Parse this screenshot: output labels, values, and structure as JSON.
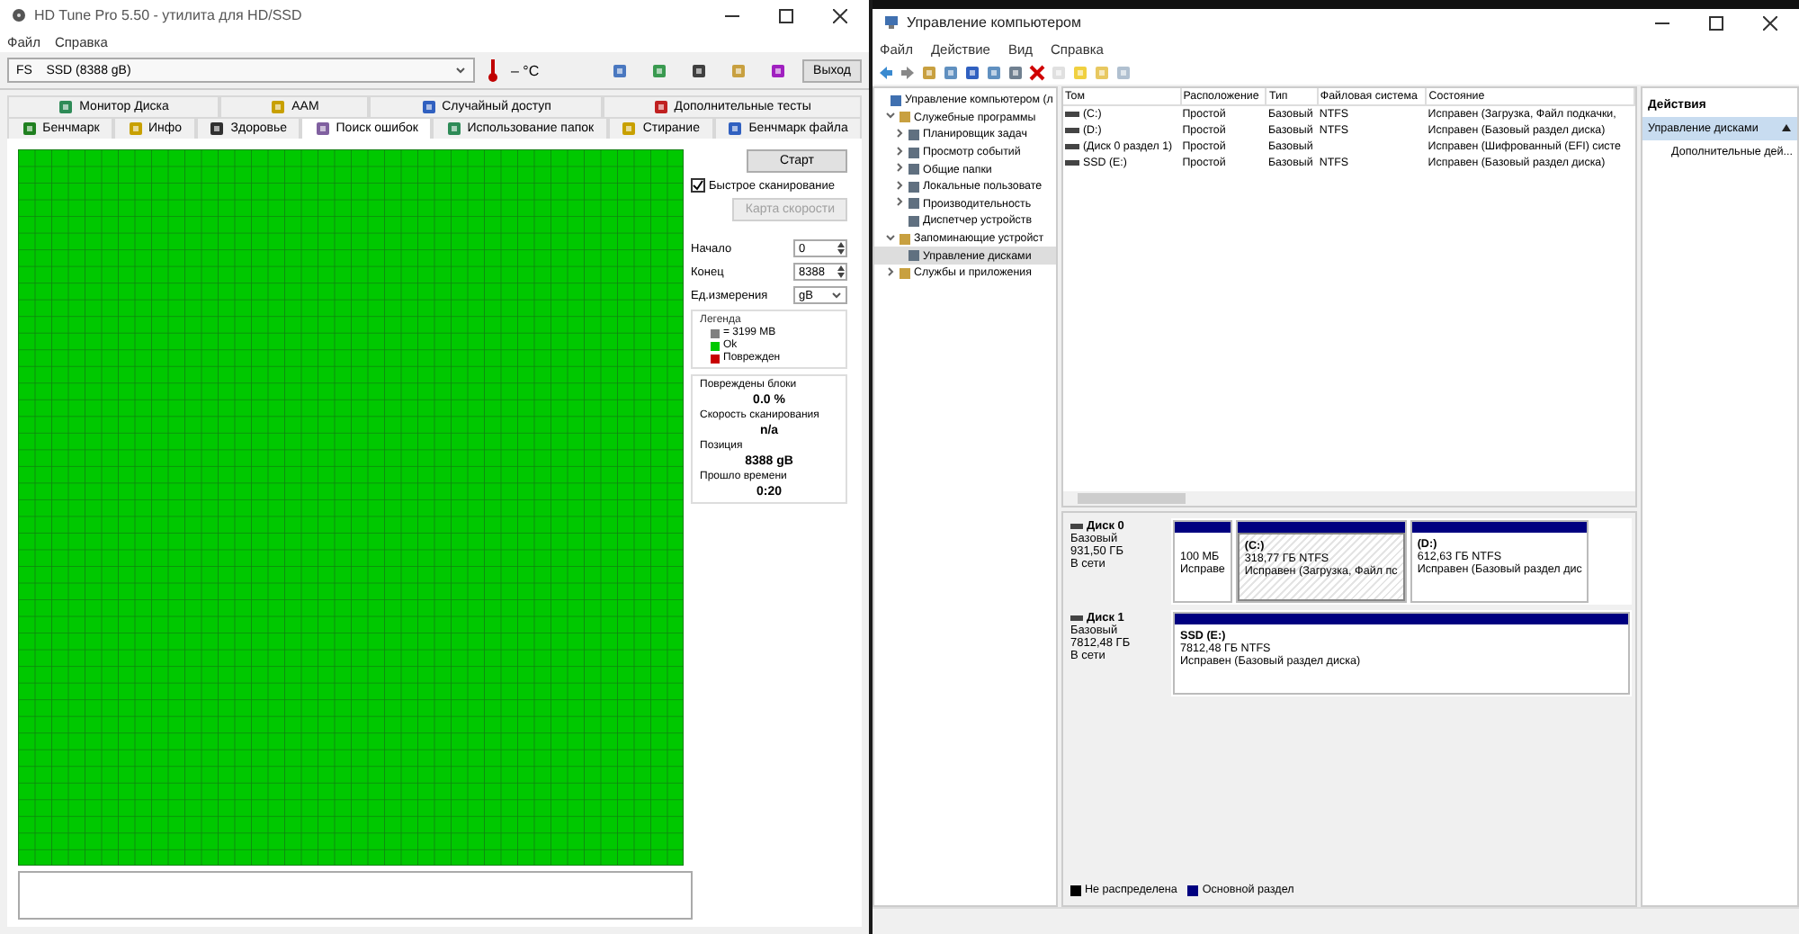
{
  "hdtune": {
    "window": {
      "title": "HD Tune Pro 5.50 - утилита для HD/SSD"
    },
    "menu": [
      "Файл",
      "Справка"
    ],
    "drive": {
      "value": "FS    SSD (8388 gB)"
    },
    "temperature": "– °C",
    "exit_button": "Выход",
    "tabs_top": [
      {
        "label": "Монитор Диска",
        "selected": false
      },
      {
        "label": "AAM",
        "selected": false
      },
      {
        "label": "Случайный доступ",
        "selected": false
      },
      {
        "label": "Дополнительные  тесты",
        "selected": false
      }
    ],
    "tabs_bottom": [
      {
        "label": "Бенчмарк",
        "selected": false
      },
      {
        "label": "Инфо",
        "selected": false
      },
      {
        "label": "Здоровье",
        "selected": false
      },
      {
        "label": "Поиск ошибок",
        "selected": true
      },
      {
        "label": "Использование папок",
        "selected": false
      },
      {
        "label": "Стирание",
        "selected": false
      },
      {
        "label": "Бенчмарк файла",
        "selected": false
      }
    ],
    "start_button": "Старт",
    "quick_scan": {
      "label": "Быстрое сканирование",
      "checked": true
    },
    "speed_map_button": {
      "label": "Карта скорости",
      "disabled": true
    },
    "fields": [
      {
        "label": "Начало",
        "value": "0",
        "kind": "spin"
      },
      {
        "label": "Конец",
        "value": "8388",
        "kind": "spin"
      },
      {
        "label": "Ед.измерения",
        "value": "gB",
        "kind": "select"
      }
    ],
    "legend": {
      "title": "Легенда",
      "items": [
        {
          "label": "= 3199 MB",
          "color": "#808080"
        },
        {
          "label": "Ok",
          "color": "#00c800"
        },
        {
          "label": "Поврежден",
          "color": "#c80000"
        }
      ]
    },
    "stats": [
      {
        "label": "Повреждены блоки",
        "value": "0.0 %"
      },
      {
        "label": "Скорость сканирования",
        "value": "n/a"
      },
      {
        "label": "Позиция",
        "value": "8388 gB"
      },
      {
        "label": "Прошло времени",
        "value": "0:20"
      }
    ]
  },
  "computer_management": {
    "window": {
      "title": "Управление компьютером"
    },
    "menu": [
      "Файл",
      "Действие",
      "Вид",
      "Справка"
    ],
    "tree": [
      {
        "label": "Управление компьютером (л",
        "selected": false,
        "children": [
          {
            "label": "Служебные программы",
            "expanded": true,
            "selected": false,
            "children": [
              {
                "label": "Планировщик задач",
                "expanded": false,
                "selected": false
              },
              {
                "label": "Просмотр событий",
                "expanded": false,
                "selected": false
              },
              {
                "label": "Общие папки",
                "expanded": false,
                "selected": false
              },
              {
                "label": "Локальные пользовате",
                "expanded": false,
                "selected": false
              },
              {
                "label": "Производительность",
                "expanded": false,
                "selected": false
              },
              {
                "label": "Диспетчер устройств",
                "selected": false
              }
            ]
          },
          {
            "label": "Запоминающие устройст",
            "expanded": true,
            "selected": false,
            "children": [
              {
                "label": "Управление дисками",
                "selected": true
              }
            ]
          },
          {
            "label": "Службы и приложения",
            "expanded": false,
            "selected": false
          }
        ]
      }
    ],
    "table": {
      "columns": [
        "Том",
        "Расположение",
        "Тип",
        "Файловая система",
        "Состояние"
      ],
      "rows": [
        [
          "(C:)",
          "Простой",
          "Базовый",
          "NTFS",
          "Исправен (Загрузка, Файл подкачки,"
        ],
        [
          "(D:)",
          "Простой",
          "Базовый",
          "NTFS",
          "Исправен (Базовый раздел диска)"
        ],
        [
          "(Диск 0 раздел 1)",
          "Простой",
          "Базовый",
          "",
          "Исправен (Шифрованный (EFI) систе"
        ],
        [
          "SSD (E:)",
          "Простой",
          "Базовый",
          "NTFS",
          "Исправен (Базовый раздел диска)"
        ]
      ]
    },
    "disks": [
      {
        "name": "Диск 0",
        "type": "Базовый",
        "size": "931,50 ГБ",
        "status": "В сети",
        "partitions": [
          {
            "size": "100 МБ",
            "status": "Исправе",
            "selected": false
          },
          {
            "label": "(C:)",
            "size": "318,77 ГБ NTFS",
            "status": "Исправен (Загрузка, Файл пс",
            "selected": true
          },
          {
            "label": "(D:)",
            "size": "612,63 ГБ NTFS",
            "status": "Исправен (Базовый раздел дис",
            "selected": false
          }
        ]
      },
      {
        "name": "Диск 1",
        "type": "Базовый",
        "size": "7812,48 ГБ",
        "status": "В сети",
        "partitions": [
          {
            "label": "SSD  (E:)",
            "size": "7812,48 ГБ NTFS",
            "status": "Исправен (Базовый раздел диска)",
            "selected": false
          }
        ]
      }
    ],
    "legend": [
      {
        "label": "Не распределена",
        "color": "#000000"
      },
      {
        "label": "Основной раздел",
        "color": "#000080"
      }
    ],
    "actions": {
      "title": "Действия",
      "section": "Управление дисками",
      "items": [
        "Дополнительные дей..."
      ]
    }
  }
}
